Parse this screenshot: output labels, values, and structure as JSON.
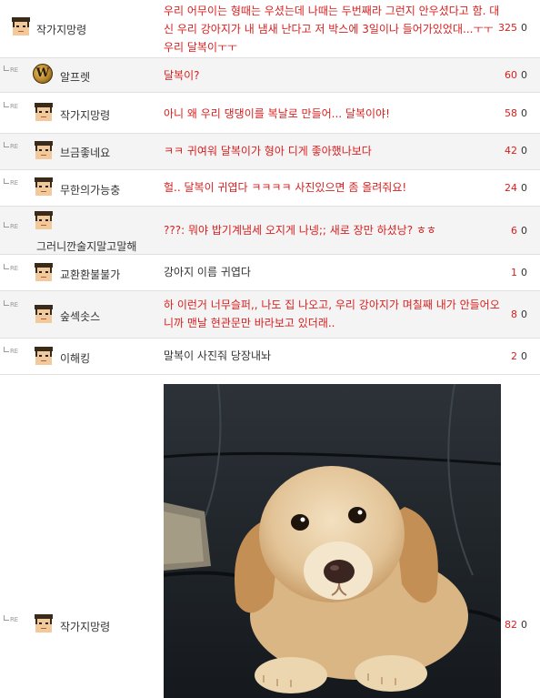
{
  "re_label": "RE",
  "comments": [
    {
      "nick": "작가지망령",
      "avatar": "pixel-face-icon",
      "message": "우리 어무이는 형때는 우셨는데 나때는 두번째라 그런지 안우셨다고 함. 대신 우리 강아지가 내 냄새 난다고 저 박스에 3일이나 들어가있었대...ㅜㅜ 우리 달복이ㅜㅜ",
      "up": "325",
      "down": "0"
    },
    {
      "nick": "알프렛",
      "avatar": "wow-logo-icon",
      "avatar_letter": "W",
      "message": "달복이?",
      "up": "60",
      "down": "0"
    },
    {
      "nick": "작가지망령",
      "avatar": "pixel-face-icon",
      "message": "아니 왜 우리 댕댕이를 복날로 만들어... 달복이야!",
      "up": "58",
      "down": "0"
    },
    {
      "nick": "브금좋네요",
      "avatar": "pixel-face-icon",
      "message": "ㅋㅋ 귀여워 달복이가 형아 디게 좋아했나보다",
      "up": "42",
      "down": "0"
    },
    {
      "nick": "무한의가능충",
      "avatar": "pixel-face-icon",
      "message": "헐.. 달복이 귀엽다 ㅋㅋㅋㅋ 사진있으면 좀 올려줘요!",
      "up": "24",
      "down": "0"
    },
    {
      "nick": "그러니깐술지말고말해",
      "avatar": "pixel-face-icon",
      "message": "???: 뭐야 밥기계냄세 오지게 나넹;; 새로 장만 하셨낭? ㅎㅎ",
      "up": "6",
      "down": "0"
    },
    {
      "nick": "교환환불불가",
      "avatar": "pixel-face-icon",
      "message": "강아지 이름 귀엽다",
      "up": "1",
      "down": "0"
    },
    {
      "nick": "숲섹솟스",
      "avatar": "pixel-face-icon",
      "message": "하 이런거 너무슬퍼,, 나도 집 나오고, 우리 강아지가 며칠째 내가 안들어오니까 맨날 현관문만 바라보고 있더래..",
      "up": "8",
      "down": "0"
    },
    {
      "nick": "이해킹",
      "avatar": "pixel-face-icon",
      "message": "말복이 사진줘 당장내놔",
      "up": "2",
      "down": "0"
    },
    {
      "nick": "작가지망령",
      "avatar": "pixel-face-icon",
      "attachment": "dog-photo",
      "up": "82",
      "down": "0"
    }
  ],
  "colors": {
    "accent_red": "#d81e1e",
    "alt_row": "#f4f4f4",
    "border": "#e0e0e0"
  }
}
